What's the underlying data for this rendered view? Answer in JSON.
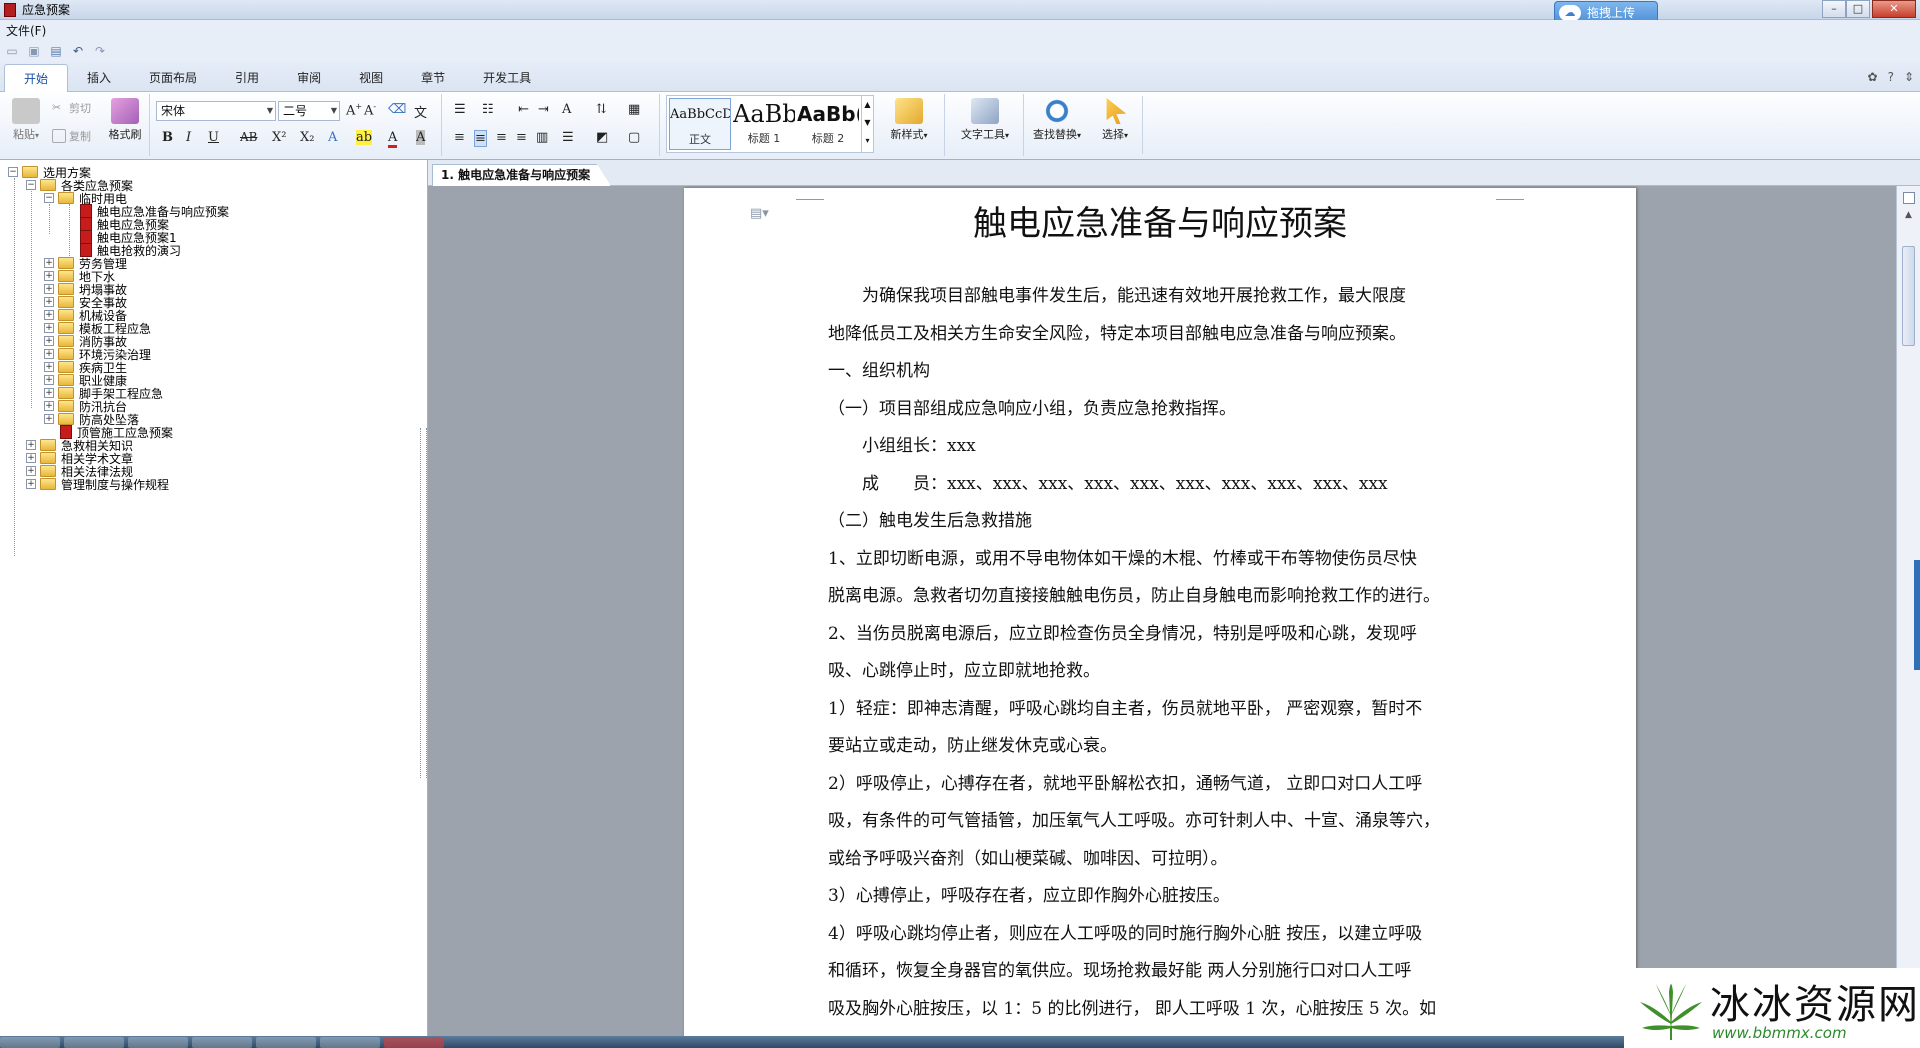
{
  "window": {
    "title": "应急预案",
    "upload_label": "拖拽上传",
    "minimize": "–",
    "maximize": "□",
    "close": "✕"
  },
  "menubar": {
    "file": "文件(F)"
  },
  "ribbon_tabs": [
    "开始",
    "插入",
    "页面布局",
    "引用",
    "审阅",
    "视图",
    "章节",
    "开发工具"
  ],
  "ribbon": {
    "paste": "粘贴",
    "cut": "剪切",
    "copy": "复制",
    "format_painter": "格式刷",
    "font_name": "宋体",
    "font_size": "二号",
    "styles": [
      {
        "sample": "AaBbCcDd",
        "name": "正文"
      },
      {
        "sample": "AaBb",
        "name": "标题 1"
      },
      {
        "sample": "AaBb(",
        "name": "标题 2"
      }
    ],
    "new_style": "新样式",
    "text_tools": "文字工具",
    "find_replace": "查找替换",
    "select": "选择"
  },
  "tree": {
    "root": "选用方案",
    "category": "各类应急预案",
    "temp_power": "临时用电",
    "temp_power_docs": [
      "触电应急准备与响应预案",
      "触电应急预案",
      "触电应急预案1",
      "触电抢救的演习"
    ],
    "category_children": [
      "劳务管理",
      "地下水",
      "坍塌事故",
      "安全事故",
      "机械设备",
      "模板工程应急",
      "消防事故",
      "环境污染治理",
      "疾病卫生",
      "职业健康",
      "脚手架工程应急",
      "防汛抗台",
      "防高处坠落"
    ],
    "category_doc": "顶管施工应急预案",
    "root_children": [
      "急救相关知识",
      "相关学术文章",
      "相关法律法规",
      "管理制度与操作规程"
    ]
  },
  "document": {
    "tab_label": "1. 触电应急准备与响应预案",
    "title": "触电应急准备与响应预案",
    "paragraphs": [
      "　　为确保我项目部触电事件发生后，能迅速有效地开展抢救工作，最大限度",
      "地降低员工及相关方生命安全风险，特定本项目部触电应急准备与响应预案。",
      "一、组织机构",
      "（一）项目部组成应急响应小组，负责应急抢救指挥。",
      "　　小组组长：xxx",
      "　　成　　员：xxx、xxx、xxx、xxx、xxx、xxx、xxx、xxx、xxx、xxx",
      "（二）触电发生后急救措施",
      "1、立即切断电源，或用不导电物体如干燥的木棍、竹棒或干布等物使伤员尽快",
      "脱离电源。急救者切勿直接接触触电伤员，防止自身触电而影响抢救工作的进行。",
      "2、当伤员脱离电源后，应立即检查伤员全身情况，特别是呼吸和心跳，发现呼",
      "吸、心跳停止时，应立即就地抢救。",
      "1）轻症：即神志清醒，呼吸心跳均自主者，伤员就地平卧，  严密观察，暂时不",
      "要站立或走动，防止继发休克或心衰。",
      "2）呼吸停止，心搏存在者，就地平卧解松衣扣，通畅气道，  立即口对口人工呼",
      "吸，有条件的可气管插管，加压氧气人工呼吸。亦可针刺人中、十宣、涌泉等穴，",
      "或给予呼吸兴奋剂（如山梗菜碱、咖啡因、可拉明）。",
      "3）心搏停止，呼吸存在者，应立即作胸外心脏按压。",
      "4）呼吸心跳均停止者，则应在人工呼吸的同时施行胸外心脏 按压，以建立呼吸",
      "和循环，恢复全身器官的氧供应。现场抢救最好能 两人分别施行口对口人工呼",
      "吸及胸外心脏按压，以 1：5 的比例进行，  即人工呼吸 1 次，心脏按压 5 次。如"
    ]
  },
  "watermark": {
    "title": "冰冰资源网",
    "url": "www.bbmmx.com"
  },
  "colors": {
    "accent": "#1a4fa0",
    "doc_icon": "#c71c1c",
    "folder": "#e8b73c"
  }
}
